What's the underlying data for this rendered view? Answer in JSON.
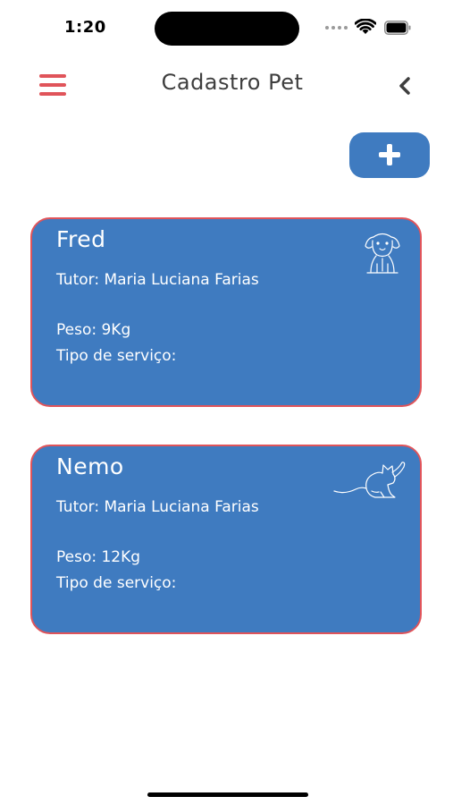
{
  "status_bar": {
    "time": "1:20",
    "icons": [
      "cellular-signal-icon",
      "wifi-icon",
      "battery-icon"
    ]
  },
  "header": {
    "title": "Cadastro Pet",
    "menu_icon": "hamburger-menu-icon",
    "back_icon": "chevron-left-icon"
  },
  "actions": {
    "add_icon": "plus-icon"
  },
  "pets": [
    {
      "name": "Fred",
      "tutor": "Tutor: Maria Luciana Farias",
      "peso": "Peso:  9Kg",
      "servico": "Tipo de serviço:",
      "icon": "dog-icon"
    },
    {
      "name": "Nemo",
      "tutor": "Tutor: Maria Luciana Farias",
      "peso": "Peso:  12Kg",
      "servico": "Tipo de serviço:",
      "icon": "cat-icon"
    }
  ],
  "colors": {
    "accent_red": "#e0545a",
    "card_blue": "#3f7bc0",
    "title_gray": "#3e3e3e",
    "background": "#ffffff"
  }
}
